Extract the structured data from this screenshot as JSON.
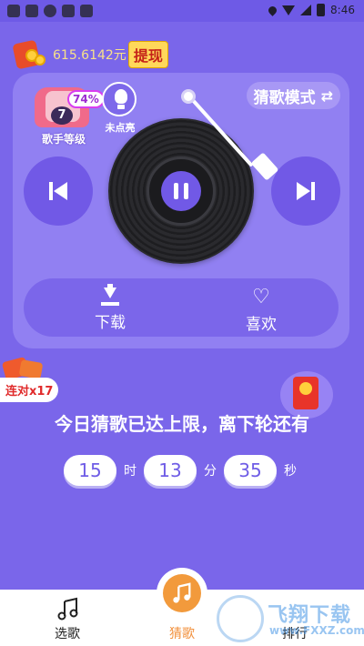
{
  "status_bar": {
    "time": "8:46"
  },
  "header": {
    "balance": "615.6142元",
    "withdraw_label": "提现"
  },
  "panel": {
    "level": {
      "number": "7",
      "percent": "74%",
      "label": "歌手等级"
    },
    "hint": {
      "label": "未点亮"
    },
    "mode_label": "猜歌模式",
    "mode_icon": "swap-arrows-icon",
    "player": {
      "state": "playing"
    },
    "actions": {
      "download_label": "下载",
      "favorite_label": "喜欢"
    }
  },
  "streak": {
    "label": "连对x17"
  },
  "limit_message": "今日猜歌已达上限，离下轮还有",
  "countdown": {
    "hours": "15",
    "hours_unit": "时",
    "minutes": "13",
    "minutes_unit": "分",
    "seconds": "35",
    "seconds_unit": "秒"
  },
  "tabbar": {
    "tabs": [
      {
        "label": "选歌",
        "icon": "music-note-icon"
      },
      {
        "label": "猜歌",
        "icon": "music-note-icon",
        "active": true
      },
      {
        "label": "排行",
        "icon": "ranking-icon"
      }
    ]
  },
  "watermark": {
    "title": "飞翔下载",
    "url": "www.FXXZ.com"
  },
  "colors": {
    "background": "#7a66ea",
    "panel": "#9180f2",
    "accent": "#f29a3c",
    "withdraw": "#ffd85a"
  }
}
